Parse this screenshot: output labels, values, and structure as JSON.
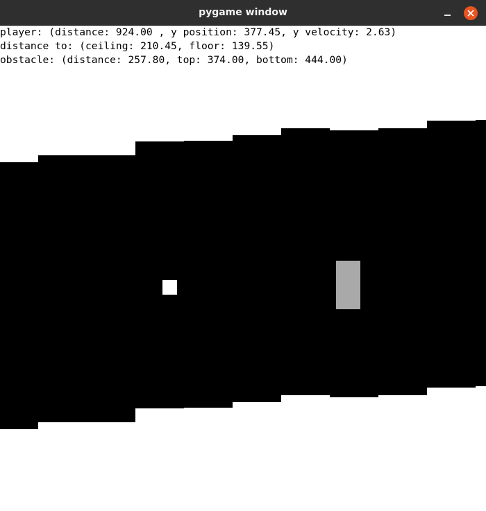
{
  "window": {
    "title": "pygame window",
    "titlebar_color": "#2f2f2f",
    "close_button_color": "#e95420"
  },
  "hud": {
    "player_line": "player: (distance: 924.00 , y position: 377.45, y velocity: 2.63)",
    "distance_line": "distance to: (ceiling: 210.45, floor: 139.55)",
    "obstacle_line": "obstacle: (distance: 257.80, top: 374.00, bottom: 444.00)"
  },
  "game": {
    "background_color": "#ffffff",
    "tunnel_color": "#000000",
    "player_color": "#ffffff",
    "obstacle_color": "#a9a9a9",
    "player": {
      "distance": 924.0,
      "y_position": 377.45,
      "y_velocity": 2.63
    },
    "distance_to": {
      "ceiling": 210.45,
      "floor": 139.55
    },
    "obstacle": {
      "distance": 257.8,
      "top": 374.0,
      "bottom": 444.0
    }
  }
}
